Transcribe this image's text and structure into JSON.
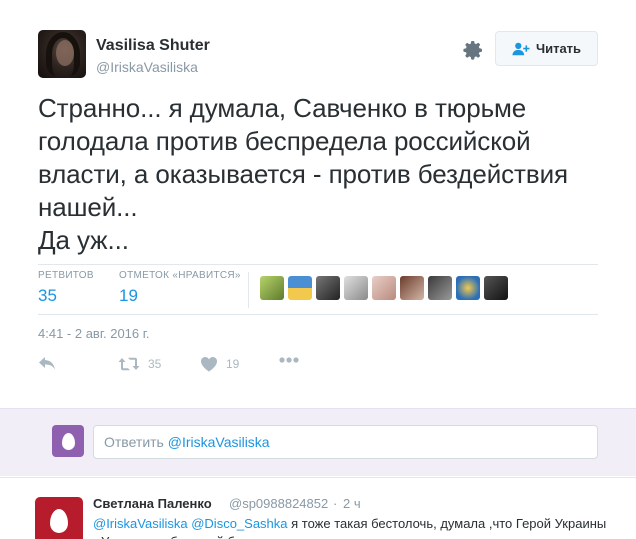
{
  "tweet": {
    "fullname": "Vasilisa Shuter",
    "screenname": "@IriskaVasiliska",
    "follow_label": "Читать",
    "text": "Странно... я думала, Савченко в тюрьме\nголодала против беспредела российской\nвласти, а оказывается - против бездействия\nнашей...\nДа уж...",
    "stats": {
      "retweets_label": "РЕТВИТОВ",
      "retweets_count": "35",
      "likes_label": "ОТМЕТОК «НРАВИТСЯ»",
      "likes_count": "19"
    },
    "timestamp": "4:41 - 2 авг. 2016 г.",
    "actions": {
      "retweet_count": "35",
      "like_count": "19"
    },
    "likers": [
      "liker-1",
      "liker-2",
      "liker-3",
      "liker-4",
      "liker-5",
      "liker-6",
      "liker-7",
      "liker-8",
      "liker-9"
    ]
  },
  "reply_box": {
    "prefix": "Ответить ",
    "handle": "@IriskaVasiliska"
  },
  "reply_tweet": {
    "fullname": "Светлана Паленко",
    "screenname": "@sp0988824852",
    "dot": "·",
    "time": "2 ч",
    "mention1": "@IriskaVasiliska",
    "mention2": "@Disco_Sashka",
    "text": " я тоже такая бестолочь, думала ,что  Герой Украины - Украинка с большой буквы..."
  },
  "colors": {
    "link": "#1b95e0",
    "muted": "#8899a6",
    "reply_bg": "#f2eef7",
    "egg_purple": "#8f5fb0",
    "egg_red": "#b71c2c"
  }
}
